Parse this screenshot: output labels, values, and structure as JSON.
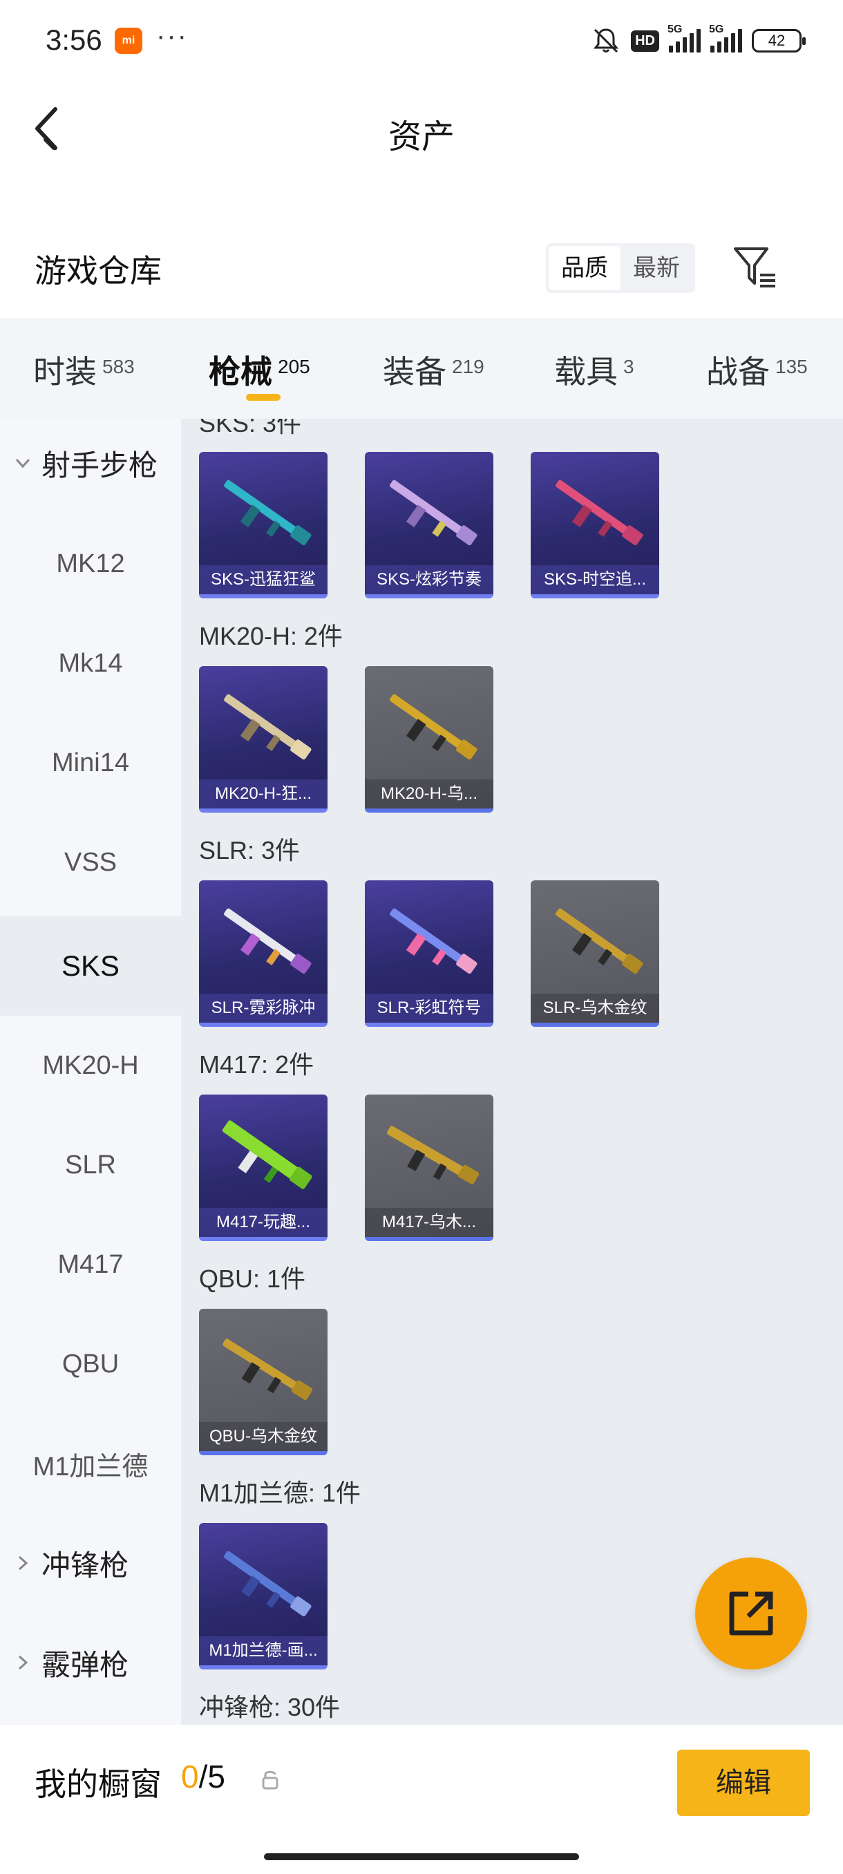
{
  "status_bar": {
    "time": "3:56",
    "mi_label": "mi",
    "dots": "···",
    "hd_label": "HD",
    "net1": "5G",
    "net2": "5G",
    "battery": "42"
  },
  "header": {
    "title": "资产"
  },
  "warehouse": {
    "title": "游戏仓库",
    "sort_options": [
      "品质",
      "最新"
    ],
    "sort_selected": "品质"
  },
  "tabs": [
    {
      "label": "时装",
      "count": "583"
    },
    {
      "label": "枪械",
      "count": "205"
    },
    {
      "label": "装备",
      "count": "219"
    },
    {
      "label": "载具",
      "count": "3"
    },
    {
      "label": "战备",
      "count": "135"
    }
  ],
  "active_tab": "枪械",
  "sidebar": {
    "groups": [
      "射手步枪",
      "冲锋枪",
      "霰弹枪"
    ],
    "items": [
      "MK12",
      "Mk14",
      "Mini14",
      "VSS",
      "SKS",
      "MK20-H",
      "SLR",
      "M417",
      "QBU",
      "M1加兰德"
    ],
    "active_item": "SKS"
  },
  "content": {
    "partial_head": "SKS: 3件",
    "groups": [
      {
        "heading": "MK20-H: 2件"
      },
      {
        "heading": "SLR: 3件"
      },
      {
        "heading": "M417: 2件"
      },
      {
        "heading": "QBU: 1件"
      },
      {
        "heading": "M1加兰德: 1件"
      },
      {
        "heading": "冲锋枪: 30件"
      }
    ],
    "cards": [
      {
        "caption": "SKS-迅猛狂鲨",
        "style": "purple"
      },
      {
        "caption": "SKS-炫彩节奏",
        "style": "purple"
      },
      {
        "caption": "SKS-时空追...",
        "style": "purple"
      },
      {
        "caption": "MK20-H-狂...",
        "style": "purple"
      },
      {
        "caption": "MK20-H-乌...",
        "style": "gray"
      },
      {
        "caption": "SLR-霓彩脉冲",
        "style": "purple"
      },
      {
        "caption": "SLR-彩虹符号",
        "style": "purple"
      },
      {
        "caption": "SLR-乌木金纹",
        "style": "gray"
      },
      {
        "caption": "M417-玩趣...",
        "style": "purple"
      },
      {
        "caption": "M417-乌木...",
        "style": "gray"
      },
      {
        "caption": "QBU-乌木金纹",
        "style": "gray"
      },
      {
        "caption": "M1加兰德-画...",
        "style": "purple"
      }
    ]
  },
  "bottom": {
    "window_label": "我的橱窗",
    "count_current": "0",
    "count_sep": "/",
    "count_total": "5",
    "edit_label": "编辑"
  },
  "colors": {
    "accent": "#f6b418",
    "fab": "#f5a20a",
    "card_purple": "#2c2a6e",
    "card_gray": "#5a5b62"
  }
}
